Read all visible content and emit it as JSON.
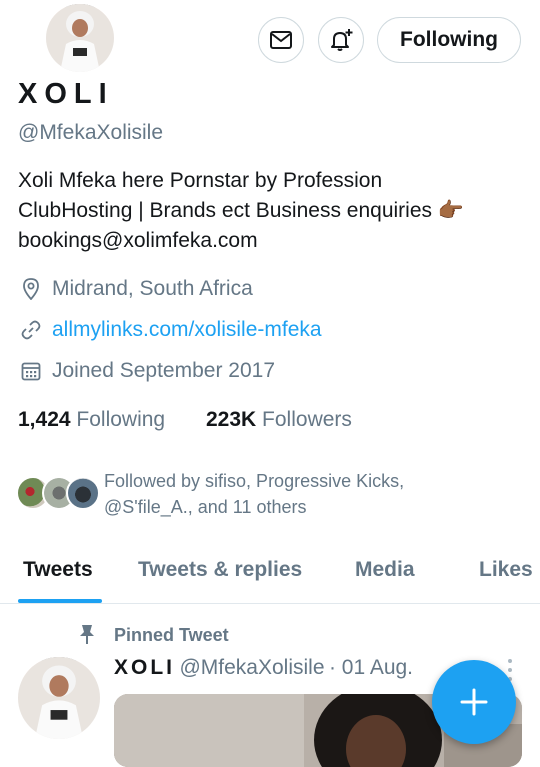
{
  "profile": {
    "display_name": "XOLI",
    "handle": "@MfekaXolisile",
    "bio_line1": "Xoli Mfeka here Pornstar by Profession",
    "bio_line2": "ClubHosting | Brands ect Business enquiries 👉🏾",
    "bio_line3": "bookings@xolimfeka.com",
    "location": "Midrand, South Africa",
    "website": "allmylinks.com/xolisile-mfeka",
    "joined": "Joined September 2017",
    "following_count": "1,424",
    "following_label": "Following",
    "followers_count": "223K",
    "followers_label": "Followers",
    "followed_by_line1": "Followed by sifiso, Progressive Kicks,",
    "followed_by_line2": "@S'file_A., and 11 others"
  },
  "header": {
    "follow_button_label": "Following"
  },
  "tabs": [
    {
      "label": "Tweets",
      "active": true
    },
    {
      "label": "Tweets & replies",
      "active": false
    },
    {
      "label": "Media",
      "active": false
    },
    {
      "label": "Likes",
      "active": false
    }
  ],
  "pinned_tweet": {
    "pinned_label": "Pinned Tweet",
    "author_name": "XOLI",
    "author_handle": "@MfekaXolisile",
    "date": "· 01 Aug."
  },
  "colors": {
    "accent": "#1da1f2",
    "text_primary": "#14171a",
    "text_secondary": "#657786"
  },
  "icons": {
    "message": "mail-icon",
    "notify": "bell-plus-icon",
    "location": "location-pin-icon",
    "link": "link-icon",
    "calendar": "calendar-icon",
    "pin": "pin-icon",
    "compose": "plus-icon",
    "more": "more-vertical-icon"
  }
}
